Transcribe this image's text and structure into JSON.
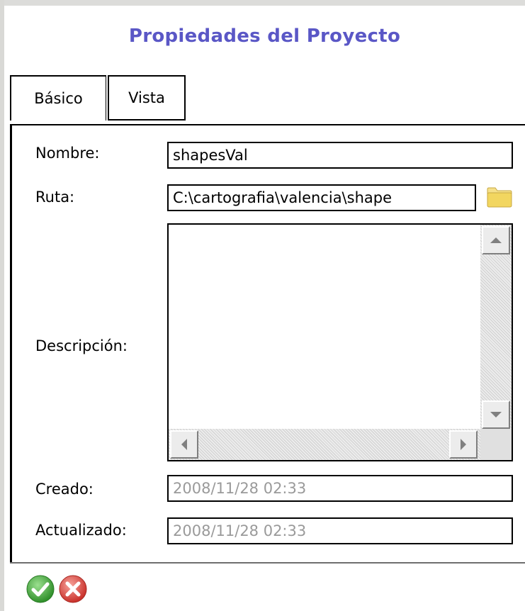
{
  "dialog": {
    "title": "Propiedades del Proyecto"
  },
  "tabs": [
    {
      "label": "Básico",
      "active": true
    },
    {
      "label": "Vista",
      "active": false
    }
  ],
  "form": {
    "nombre_label": "Nombre:",
    "nombre_value": "shapesVal",
    "ruta_label": "Ruta:",
    "ruta_value": "C:\\cartografia\\valencia\\shape",
    "descripcion_label": "Descripción:",
    "descripcion_value": "",
    "creado_label": "Creado:",
    "creado_value": "2008/11/28 02:33",
    "actualizado_label": "Actualizado:",
    "actualizado_value": "2008/11/28 02:33"
  },
  "icons": {
    "browse": "folder-icon",
    "accept": "check-icon",
    "cancel": "close-icon"
  },
  "colors": {
    "title": "#5a57c6",
    "accept": "#3ca335",
    "cancel": "#d9433b",
    "folder": "#f2d660",
    "readonly_text": "#9a9a9a"
  }
}
